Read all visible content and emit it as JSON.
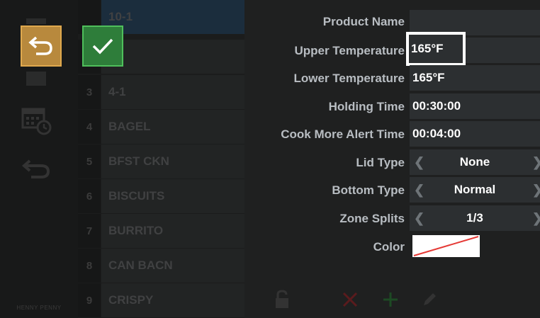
{
  "brand": "HENNY PENNY",
  "nav": {
    "back_icon": "undo-arrow-icon",
    "confirm_icon": "checkmark-icon"
  },
  "sidebar_icons": [
    "menu-stack-icon",
    "calendar-clock-icon",
    "return-arrow-icon"
  ],
  "products": [
    {
      "num": "",
      "name": "10-1",
      "selected": true
    },
    {
      "num": "",
      "name": "",
      "selected": false
    },
    {
      "num": "3",
      "name": "4-1",
      "selected": false
    },
    {
      "num": "4",
      "name": "BAGEL",
      "selected": false
    },
    {
      "num": "5",
      "name": "BFST CKN",
      "selected": false
    },
    {
      "num": "6",
      "name": "BISCUITS",
      "selected": false
    },
    {
      "num": "7",
      "name": "BURRITO",
      "selected": false
    },
    {
      "num": "8",
      "name": "CAN BACN",
      "selected": false
    },
    {
      "num": "9",
      "name": "CRISPY",
      "selected": false
    }
  ],
  "settings": {
    "product_name": {
      "label": "Product Name",
      "value": ""
    },
    "upper_temperature": {
      "label": "Upper Temperature",
      "value": "165°F"
    },
    "lower_temperature": {
      "label": "Lower Temperature",
      "value": "165°F"
    },
    "holding_time": {
      "label": "Holding Time",
      "value": "00:30:00"
    },
    "cook_more_alert_time": {
      "label": "Cook More Alert Time",
      "value": "00:04:00"
    },
    "lid_type": {
      "label": "Lid Type",
      "value": "None"
    },
    "bottom_type": {
      "label": "Bottom Type",
      "value": "Normal"
    },
    "zone_splits": {
      "label": "Zone Splits",
      "value": "1/3"
    },
    "color": {
      "label": "Color",
      "value_icon": "no-color-swatch",
      "slash_color": "#e53935"
    }
  },
  "arrows": {
    "left": "❮",
    "right": "❯"
  },
  "toolbar": [
    "lock-icon",
    "delete-x-icon",
    "add-plus-icon",
    "edit-pencil-icon"
  ],
  "colors": {
    "background": "#1f2020",
    "accent_back": "#b8893d",
    "accent_confirm": "#2e7d3a",
    "selected_row": "#1b2d3d",
    "delete": "#b3262a",
    "add": "#2e7d3a"
  }
}
